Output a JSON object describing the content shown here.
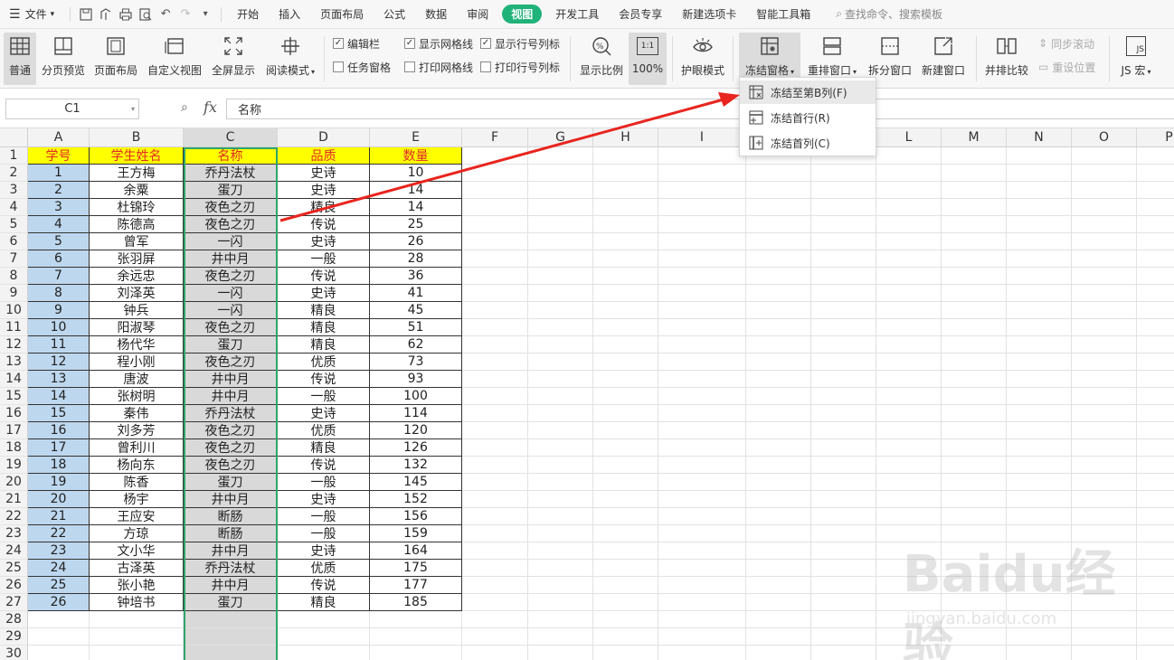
{
  "menubar": {
    "file": "文件",
    "tabs": [
      "开始",
      "插入",
      "页面布局",
      "公式",
      "数据",
      "审阅",
      "视图",
      "开发工具",
      "会员专享",
      "新建选项卡",
      "智能工具箱"
    ],
    "active_tab": "视图",
    "search": "查找命令、搜索模板"
  },
  "ribbon": {
    "normal": "普通",
    "page_break_preview": "分页预览",
    "page_layout": "页面布局",
    "custom_view": "自定义视图",
    "full_screen": "全屏显示",
    "reading_mode": "阅读模式",
    "chk_formula_bar": "编辑栏",
    "chk_task_pane": "任务窗格",
    "chk_gridlines": "显示网格线",
    "chk_print_gridlines": "打印网格线",
    "chk_headings": "显示行号列标",
    "chk_print_headings": "打印行号列标",
    "zoom": "显示比例",
    "zoom_100": "100%",
    "zoom_100_icon": "1:1",
    "eye_mode": "护眼模式",
    "freeze_panes": "冻结窗格",
    "arrange_all": "重排窗口",
    "split_window": "拆分窗口",
    "new_window": "新建窗口",
    "side_by_side": "并排比较",
    "sync_scroll": "同步滚动",
    "reset_position": "重设位置",
    "macro": "JS 宏",
    "macro_icon": "JS"
  },
  "formula_bar": {
    "name_box": "C1",
    "fx": "fx",
    "content": "名称"
  },
  "columns": [
    "A",
    "B",
    "C",
    "D",
    "E",
    "F",
    "G",
    "H",
    "I",
    "J",
    "K",
    "L",
    "M",
    "N",
    "O",
    "P"
  ],
  "table": {
    "headers": [
      "学号",
      "学生姓名",
      "名称",
      "品质",
      "数量"
    ],
    "rows": [
      [
        "1",
        "王方梅",
        "乔丹法杖",
        "史诗",
        "10"
      ],
      [
        "2",
        "余粟",
        "蛋刀",
        "史诗",
        "14"
      ],
      [
        "3",
        "杜锦玲",
        "夜色之刃",
        "精良",
        "14"
      ],
      [
        "4",
        "陈德高",
        "夜色之刃",
        "传说",
        "25"
      ],
      [
        "5",
        "曾军",
        "一闪",
        "史诗",
        "26"
      ],
      [
        "6",
        "张羽屏",
        "井中月",
        "一般",
        "28"
      ],
      [
        "7",
        "余远忠",
        "夜色之刃",
        "传说",
        "36"
      ],
      [
        "8",
        "刘泽英",
        "一闪",
        "史诗",
        "41"
      ],
      [
        "9",
        "钟兵",
        "一闪",
        "精良",
        "45"
      ],
      [
        "10",
        "阳淑琴",
        "夜色之刃",
        "精良",
        "51"
      ],
      [
        "11",
        "杨代华",
        "蛋刀",
        "精良",
        "62"
      ],
      [
        "12",
        "程小刚",
        "夜色之刃",
        "优质",
        "73"
      ],
      [
        "13",
        "唐波",
        "井中月",
        "传说",
        "93"
      ],
      [
        "14",
        "张树明",
        "井中月",
        "一般",
        "100"
      ],
      [
        "15",
        "秦伟",
        "乔丹法杖",
        "史诗",
        "114"
      ],
      [
        "16",
        "刘多芳",
        "夜色之刃",
        "优质",
        "120"
      ],
      [
        "17",
        "曾利川",
        "夜色之刃",
        "精良",
        "126"
      ],
      [
        "18",
        "杨向东",
        "夜色之刃",
        "传说",
        "132"
      ],
      [
        "19",
        "陈香",
        "蛋刀",
        "一般",
        "145"
      ],
      [
        "20",
        "杨宇",
        "井中月",
        "史诗",
        "152"
      ],
      [
        "21",
        "王应安",
        "断肠",
        "一般",
        "156"
      ],
      [
        "22",
        "方琼",
        "断肠",
        "一般",
        "159"
      ],
      [
        "23",
        "文小华",
        "井中月",
        "史诗",
        "164"
      ],
      [
        "24",
        "古泽英",
        "乔丹法杖",
        "优质",
        "175"
      ],
      [
        "25",
        "张小艳",
        "井中月",
        "传说",
        "177"
      ],
      [
        "26",
        "钟培书",
        "蛋刀",
        "精良",
        "185"
      ]
    ]
  },
  "total_rows": 30,
  "dropdown": {
    "items": [
      "冻结至第B列(F)",
      "冻结首行(R)",
      "冻结首列(C)"
    ]
  },
  "watermark": {
    "logo": "Baidu经验",
    "url": "jingyan.baidu.com"
  },
  "colors": {
    "accent": "#1fb37a",
    "header_fill": "#ffff00",
    "header_text": "#e02a2a",
    "col_a_fill": "#bdd7ee",
    "col_c_fill": "#d9d9d9",
    "arrow": "#e8251e"
  }
}
